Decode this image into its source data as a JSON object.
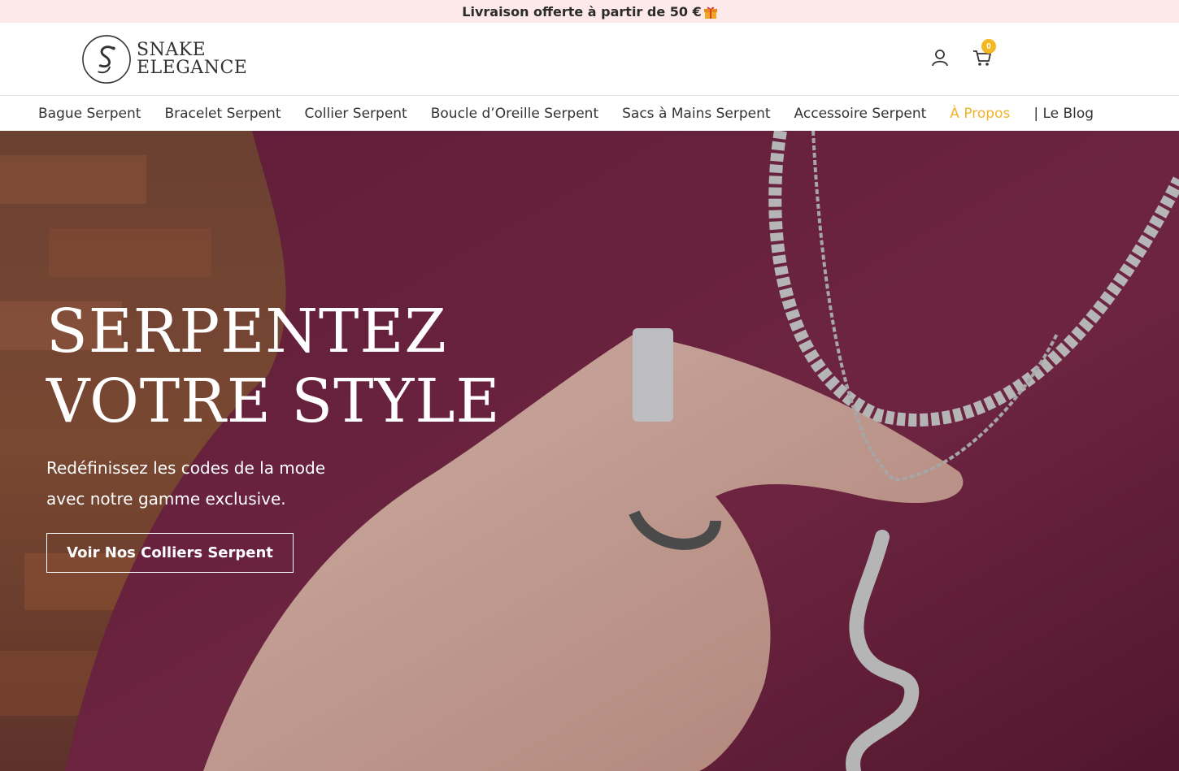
{
  "announcement": {
    "text": "Livraison offerte à partir de 50 €",
    "icon": "gift-icon"
  },
  "header": {
    "logo": {
      "line1": "SNAKE",
      "line2": "ELEGANCE"
    },
    "cart_count": "0"
  },
  "nav": {
    "items": [
      {
        "label": "Bague Serpent"
      },
      {
        "label": "Bracelet Serpent"
      },
      {
        "label": "Collier Serpent"
      },
      {
        "label": "Boucle d’Oreille Serpent"
      },
      {
        "label": "Sacs à Mains Serpent"
      },
      {
        "label": "Accessoire Serpent"
      },
      {
        "label": "À Propos",
        "active": true
      },
      {
        "label": "| Le Blog"
      }
    ]
  },
  "hero": {
    "title_line1": "SERPENTEZ",
    "title_line2": "VOTRE STYLE",
    "subtitle_line1": "Redéfinissez les codes de la mode",
    "subtitle_line2": "avec notre gamme exclusive.",
    "cta_label": "Voir Nos Colliers Serpent"
  },
  "colors": {
    "announcement_bg": "#fde9ea",
    "accent": "#f0b429",
    "cart_badge": "#f3b721",
    "hero_bg": "#7a2a45"
  }
}
